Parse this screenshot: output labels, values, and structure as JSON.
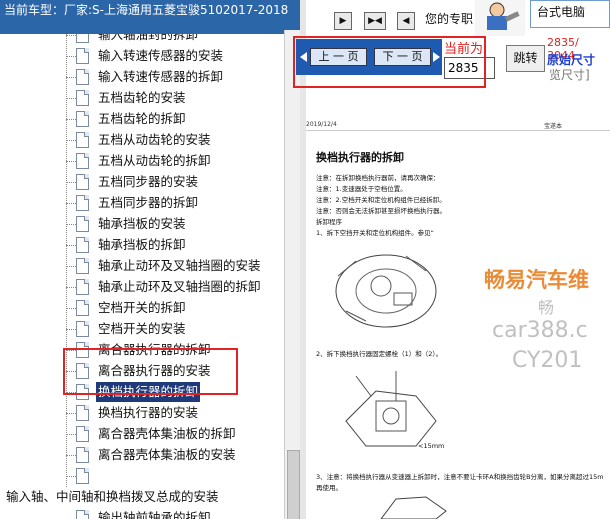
{
  "vehicle_bar": {
    "prefix": "当前车型：",
    "text": "厂家:S-上海通用五菱宝骏5102017-2018"
  },
  "tree": {
    "items": [
      {
        "label": "输入轴油封的拆卸",
        "selected": false
      },
      {
        "label": "输入转速传感器的安装",
        "selected": false
      },
      {
        "label": "输入转速传感器的拆卸",
        "selected": false
      },
      {
        "label": "五档齿轮的安装",
        "selected": false
      },
      {
        "label": "五档齿轮的拆卸",
        "selected": false
      },
      {
        "label": "五档从动齿轮的安装",
        "selected": false
      },
      {
        "label": "五档从动齿轮的拆卸",
        "selected": false
      },
      {
        "label": "五档同步器的安装",
        "selected": false
      },
      {
        "label": "五档同步器的拆卸",
        "selected": false
      },
      {
        "label": "轴承挡板的安装",
        "selected": false
      },
      {
        "label": "轴承挡板的拆卸",
        "selected": false
      },
      {
        "label": "轴承止动环及叉轴挡圈的安装",
        "selected": false
      },
      {
        "label": "轴承止动环及叉轴挡圈的拆卸",
        "selected": false
      },
      {
        "label": "空档开关的拆卸",
        "selected": false
      },
      {
        "label": "空档开关的安装",
        "selected": false
      },
      {
        "label": "离合器执行器的拆卸",
        "selected": false
      },
      {
        "label": "离合器执行器的安装",
        "selected": false
      },
      {
        "label": "换档执行器的拆卸",
        "selected": true
      },
      {
        "label": "换档执行器的安装",
        "selected": false
      },
      {
        "label": "离合器壳体集油板的拆卸",
        "selected": false
      },
      {
        "label": "离合器壳体集油板的安装",
        "selected": false
      },
      {
        "label": "",
        "selected": false
      }
    ],
    "parent_label": "输入轴、中间轴和换档拨叉总成的安装",
    "last_child": "输出轴前轴承的拆卸"
  },
  "toolbar": {
    "nav_first": "▶",
    "nav_split": "▶◀",
    "nav_prev": "◀",
    "pro_text": "您的专职",
    "brand_text": "台式电脑"
  },
  "pager": {
    "prev_label": "上 一 页",
    "next_label": "下 一 页",
    "current_label": "当前为",
    "page_value": "2835",
    "jump_label": "跳转",
    "page_count": "2835/ 3044",
    "orig_size": "原始尺寸",
    "view_size": "览尺寸]"
  },
  "document": {
    "date": "2019/12/4",
    "header_right": "宝遂本",
    "title": "换档执行器的拆卸",
    "notes": [
      "注意：在拆卸换档执行器前，请再次确保：",
      "注意：1.变速器处于空档位置。",
      "注意：2.空档开关和定位机构组件已经拆卸。",
      "注意：否则会无法拆卸甚至损坏换档执行器。",
      "拆卸程序",
      "1、拆下空挡开关和定位机构组件。参见“"
    ],
    "step2": "2、拆下换档执行器固定螺栓（1）和（2）。",
    "dimension": "<15mm",
    "step3": "3、注意：将换档执行器从变速器上拆卸时，注意不要让卡环A和换挡齿轮B分离，如果分离超过15m",
    "step3b": "再使用。",
    "watermark_main": "畅易汽车维",
    "watermark_sub1": "畅",
    "watermark_sub2": "car388.c",
    "watermark_sub3": "CY201"
  }
}
